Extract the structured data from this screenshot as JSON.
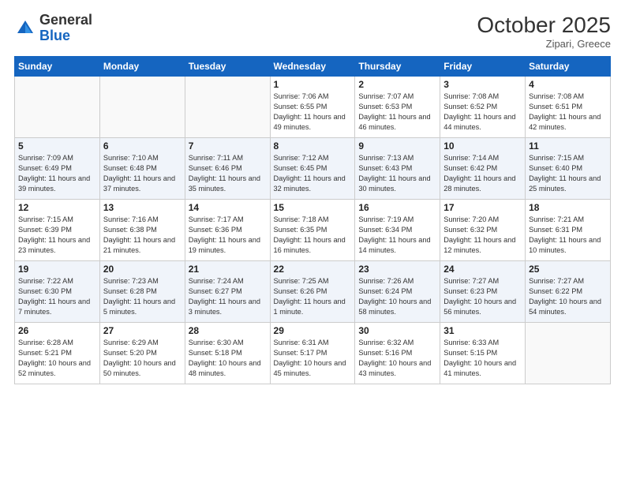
{
  "header": {
    "logo_general": "General",
    "logo_blue": "Blue",
    "month": "October 2025",
    "location": "Zipari, Greece"
  },
  "weekdays": [
    "Sunday",
    "Monday",
    "Tuesday",
    "Wednesday",
    "Thursday",
    "Friday",
    "Saturday"
  ],
  "weeks": [
    [
      {
        "day": "",
        "info": ""
      },
      {
        "day": "",
        "info": ""
      },
      {
        "day": "",
        "info": ""
      },
      {
        "day": "1",
        "info": "Sunrise: 7:06 AM\nSunset: 6:55 PM\nDaylight: 11 hours\nand 49 minutes."
      },
      {
        "day": "2",
        "info": "Sunrise: 7:07 AM\nSunset: 6:53 PM\nDaylight: 11 hours\nand 46 minutes."
      },
      {
        "day": "3",
        "info": "Sunrise: 7:08 AM\nSunset: 6:52 PM\nDaylight: 11 hours\nand 44 minutes."
      },
      {
        "day": "4",
        "info": "Sunrise: 7:08 AM\nSunset: 6:51 PM\nDaylight: 11 hours\nand 42 minutes."
      }
    ],
    [
      {
        "day": "5",
        "info": "Sunrise: 7:09 AM\nSunset: 6:49 PM\nDaylight: 11 hours\nand 39 minutes."
      },
      {
        "day": "6",
        "info": "Sunrise: 7:10 AM\nSunset: 6:48 PM\nDaylight: 11 hours\nand 37 minutes."
      },
      {
        "day": "7",
        "info": "Sunrise: 7:11 AM\nSunset: 6:46 PM\nDaylight: 11 hours\nand 35 minutes."
      },
      {
        "day": "8",
        "info": "Sunrise: 7:12 AM\nSunset: 6:45 PM\nDaylight: 11 hours\nand 32 minutes."
      },
      {
        "day": "9",
        "info": "Sunrise: 7:13 AM\nSunset: 6:43 PM\nDaylight: 11 hours\nand 30 minutes."
      },
      {
        "day": "10",
        "info": "Sunrise: 7:14 AM\nSunset: 6:42 PM\nDaylight: 11 hours\nand 28 minutes."
      },
      {
        "day": "11",
        "info": "Sunrise: 7:15 AM\nSunset: 6:40 PM\nDaylight: 11 hours\nand 25 minutes."
      }
    ],
    [
      {
        "day": "12",
        "info": "Sunrise: 7:15 AM\nSunset: 6:39 PM\nDaylight: 11 hours\nand 23 minutes."
      },
      {
        "day": "13",
        "info": "Sunrise: 7:16 AM\nSunset: 6:38 PM\nDaylight: 11 hours\nand 21 minutes."
      },
      {
        "day": "14",
        "info": "Sunrise: 7:17 AM\nSunset: 6:36 PM\nDaylight: 11 hours\nand 19 minutes."
      },
      {
        "day": "15",
        "info": "Sunrise: 7:18 AM\nSunset: 6:35 PM\nDaylight: 11 hours\nand 16 minutes."
      },
      {
        "day": "16",
        "info": "Sunrise: 7:19 AM\nSunset: 6:34 PM\nDaylight: 11 hours\nand 14 minutes."
      },
      {
        "day": "17",
        "info": "Sunrise: 7:20 AM\nSunset: 6:32 PM\nDaylight: 11 hours\nand 12 minutes."
      },
      {
        "day": "18",
        "info": "Sunrise: 7:21 AM\nSunset: 6:31 PM\nDaylight: 11 hours\nand 10 minutes."
      }
    ],
    [
      {
        "day": "19",
        "info": "Sunrise: 7:22 AM\nSunset: 6:30 PM\nDaylight: 11 hours\nand 7 minutes."
      },
      {
        "day": "20",
        "info": "Sunrise: 7:23 AM\nSunset: 6:28 PM\nDaylight: 11 hours\nand 5 minutes."
      },
      {
        "day": "21",
        "info": "Sunrise: 7:24 AM\nSunset: 6:27 PM\nDaylight: 11 hours\nand 3 minutes."
      },
      {
        "day": "22",
        "info": "Sunrise: 7:25 AM\nSunset: 6:26 PM\nDaylight: 11 hours\nand 1 minute."
      },
      {
        "day": "23",
        "info": "Sunrise: 7:26 AM\nSunset: 6:24 PM\nDaylight: 10 hours\nand 58 minutes."
      },
      {
        "day": "24",
        "info": "Sunrise: 7:27 AM\nSunset: 6:23 PM\nDaylight: 10 hours\nand 56 minutes."
      },
      {
        "day": "25",
        "info": "Sunrise: 7:27 AM\nSunset: 6:22 PM\nDaylight: 10 hours\nand 54 minutes."
      }
    ],
    [
      {
        "day": "26",
        "info": "Sunrise: 6:28 AM\nSunset: 5:21 PM\nDaylight: 10 hours\nand 52 minutes."
      },
      {
        "day": "27",
        "info": "Sunrise: 6:29 AM\nSunset: 5:20 PM\nDaylight: 10 hours\nand 50 minutes."
      },
      {
        "day": "28",
        "info": "Sunrise: 6:30 AM\nSunset: 5:18 PM\nDaylight: 10 hours\nand 48 minutes."
      },
      {
        "day": "29",
        "info": "Sunrise: 6:31 AM\nSunset: 5:17 PM\nDaylight: 10 hours\nand 45 minutes."
      },
      {
        "day": "30",
        "info": "Sunrise: 6:32 AM\nSunset: 5:16 PM\nDaylight: 10 hours\nand 43 minutes."
      },
      {
        "day": "31",
        "info": "Sunrise: 6:33 AM\nSunset: 5:15 PM\nDaylight: 10 hours\nand 41 minutes."
      },
      {
        "day": "",
        "info": ""
      }
    ]
  ]
}
